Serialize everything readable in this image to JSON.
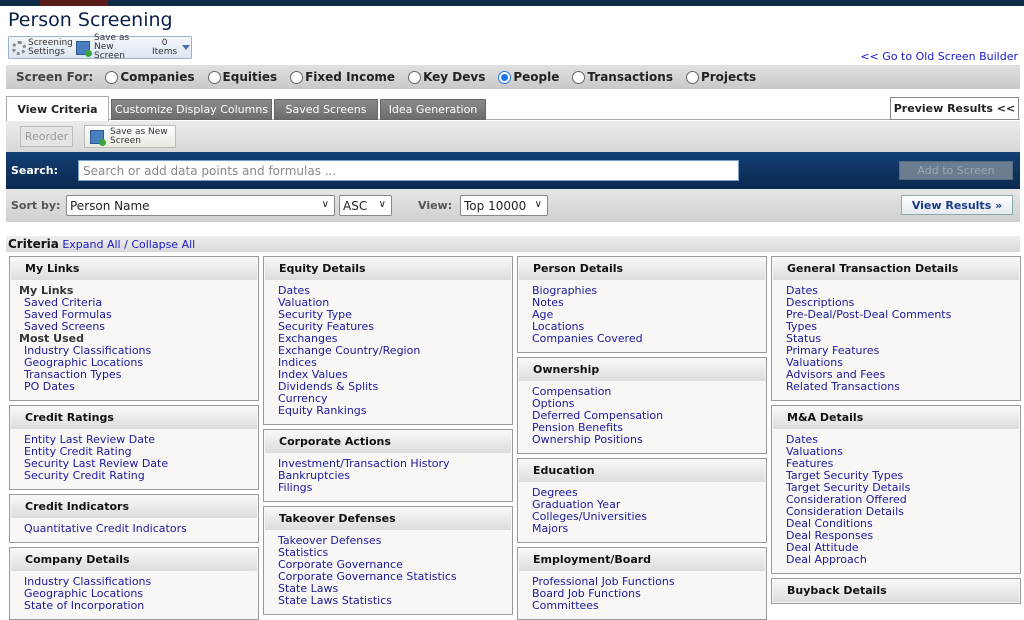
{
  "title": "Person Screening",
  "toolbar": {
    "settings": "Screening Settings",
    "save_as": "Save as New Screen",
    "items_count": "0",
    "items_label": "Items"
  },
  "old_builder_link": "<< Go to Old Screen Builder",
  "screen_for": {
    "label": "Screen For:",
    "options": [
      "Companies",
      "Equities",
      "Fixed Income",
      "Key Devs",
      "People",
      "Transactions",
      "Projects"
    ],
    "selected": "People"
  },
  "tabs": [
    "View Criteria",
    "Customize Display Columns",
    "Saved Screens",
    "Idea Generation"
  ],
  "active_tab": "View Criteria",
  "preview": "Preview Results <<",
  "subbar": {
    "reorder": "Reorder",
    "save_as": "Save as New Screen"
  },
  "search": {
    "label": "Search:",
    "placeholder": "Search or add data points and formulas ...",
    "add": "Add to Screen"
  },
  "sort": {
    "label": "Sort by:",
    "field": "Person Name",
    "order": "ASC",
    "view_label": "View:",
    "view": "Top 10000",
    "view_results": "View Results »"
  },
  "criteria": {
    "title": "Criteria",
    "expand": "Expand All",
    "sep": " / ",
    "collapse": "Collapse All"
  },
  "columns": [
    [
      {
        "title": "My Links",
        "items": [
          {
            "sub": "My Links"
          },
          "Saved Criteria",
          "Saved Formulas",
          "Saved Screens",
          {
            "sub": "Most Used"
          },
          "Industry Classifications",
          "Geographic Locations",
          "Transaction Types",
          "PO Dates"
        ]
      },
      {
        "title": "Credit Ratings",
        "items": [
          "Entity Last Review Date",
          "Entity Credit Rating",
          "Security Last Review Date",
          "Security Credit Rating"
        ]
      },
      {
        "title": "Credit Indicators",
        "items": [
          "Quantitative Credit Indicators"
        ]
      },
      {
        "title": "Company Details",
        "items": [
          "Industry Classifications",
          "Geographic Locations",
          "State of Incorporation"
        ]
      }
    ],
    [
      {
        "title": "Equity Details",
        "items": [
          "Dates",
          "Valuation",
          "Security Type",
          "Security Features",
          "Exchanges",
          "Exchange Country/Region",
          "Indices",
          "Index Values",
          "Dividends & Splits",
          "Currency",
          "Equity Rankings"
        ]
      },
      {
        "title": "Corporate Actions",
        "items": [
          "Investment/Transaction History",
          "Bankruptcies",
          "Filings"
        ]
      },
      {
        "title": "Takeover Defenses",
        "items": [
          "Takeover Defenses",
          "Statistics",
          "Corporate Governance",
          "Corporate Governance Statistics",
          "State Laws",
          "State Laws Statistics"
        ]
      }
    ],
    [
      {
        "title": "Person Details",
        "items": [
          "Biographies",
          "Notes",
          "Age",
          "Locations",
          "Companies Covered"
        ]
      },
      {
        "title": "Ownership",
        "items": [
          "Compensation",
          "Options",
          "Deferred Compensation",
          "Pension Benefits",
          "Ownership Positions"
        ]
      },
      {
        "title": "Education",
        "items": [
          "Degrees",
          "Graduation Year",
          "Colleges/Universities",
          "Majors"
        ]
      },
      {
        "title": "Employment/Board",
        "items": [
          "Professional Job Functions",
          "Board Job Functions",
          "Committees"
        ]
      }
    ],
    [
      {
        "title": "General Transaction Details",
        "items": [
          "Dates",
          "Descriptions",
          "Pre-Deal/Post-Deal Comments",
          "Types",
          "Status",
          "Primary Features",
          "Valuations",
          "Advisors and Fees",
          "Related Transactions"
        ]
      },
      {
        "title": "M&A Details",
        "items": [
          "Dates",
          "Valuations",
          "Features",
          "Target Security Types",
          "Target Security Details",
          "Consideration Offered",
          "Consideration Details",
          "Deal Conditions",
          "Deal Responses",
          "Deal Attitude",
          "Deal Approach"
        ]
      },
      {
        "title": "Buyback Details",
        "items": []
      }
    ]
  ]
}
